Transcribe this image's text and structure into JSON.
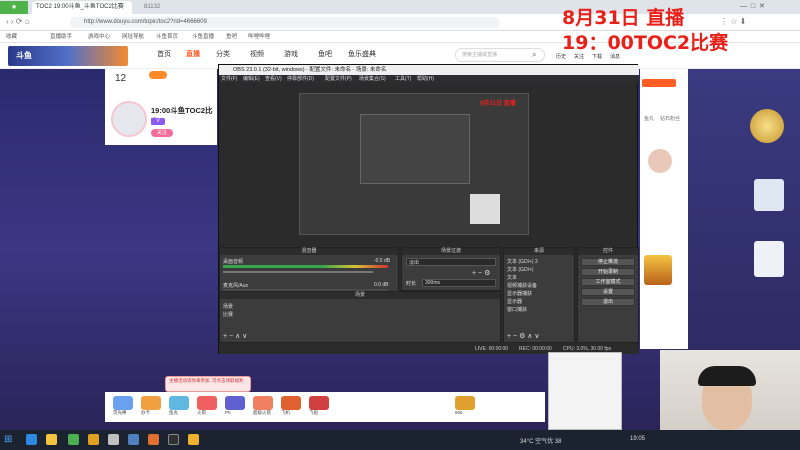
{
  "browser": {
    "tabs": [
      {
        "label": "TOC2 19:00斗鱼_斗鱼TOC2比赛"
      },
      {
        "label": "81132"
      }
    ],
    "url": "http://www.douyu.com/topic/toc2?rid=4666609",
    "bookmarks": [
      "收藏",
      "直播助手",
      "游戏中心",
      "网址导航",
      "斗鱼首页",
      "斗鱼直播",
      "鱼吧",
      "哔哩哔哩",
      "优酷视频"
    ]
  },
  "site": {
    "logo": "斗鱼",
    "nav": [
      "首页",
      "直播",
      "分类",
      "视频",
      "游戏",
      "鱼吧",
      "鱼乐盛典"
    ],
    "active_nav": "直播",
    "search_placeholder": "搜索主播或直播",
    "header_right": [
      "历史",
      "关注",
      "下载",
      "消息"
    ]
  },
  "room": {
    "follow_count": "12",
    "title": "19:00斗鱼TOC2比赛",
    "badge": "V",
    "follow_label": "关注",
    "sidebar_right": [
      "鱼丸",
      "钻石粉丝",
      "贵宾"
    ]
  },
  "overlay": {
    "line1": "8月31日 直播",
    "line2": "19：00TOC2比赛"
  },
  "obs": {
    "title": "OBS 23.0.1 (32-bit, windows) - 配置文件: 未命名 - 场景: 未命名",
    "menu": [
      "文件(F)",
      "编辑(E)",
      "查看(V)",
      "停靠部件(D)",
      "配置文件(P)",
      "场景集合(S)",
      "工具(T)",
      "帮助(H)"
    ],
    "docks": {
      "mixer": {
        "title": "混音器",
        "rows": [
          {
            "name": "桌面音频",
            "db": "-0.5 dB"
          },
          {
            "name": "麦克风/Aux",
            "db": "0.0 dB"
          }
        ]
      },
      "transition": {
        "title": "场景过渡",
        "type": "淡出",
        "duration_label": "时长",
        "duration": "300ms"
      },
      "scenes": {
        "title": "场景",
        "items": [
          "场景",
          "比赛"
        ]
      },
      "sources": {
        "title": "来源",
        "items": [
          "文本 (GDI+) 3",
          "文本 (GDI+)",
          "文本",
          "视频捕获设备",
          "显示器捕获",
          "显示器",
          "窗口捕获"
        ]
      },
      "controls": {
        "title": "控件",
        "buttons": [
          "停止推流",
          "开始录制",
          "工作室模式",
          "设置",
          "退出"
        ]
      }
    },
    "status": {
      "live": "LIVE: 00:00:00",
      "rec": "REC: 00:00:00",
      "cpu": "CPU: 3.0%, 30.00 fps"
    }
  },
  "gifts": [
    "荧光棒",
    "办卡",
    "鱼丸",
    "火箭",
    "PK",
    "超级火箭",
    "飞机",
    "飞船",
    "666"
  ],
  "promo": "主播活动等你来参加, 可点击领取福利",
  "taskbar": {
    "weather": "34°C 空气优 38",
    "clock": "19:05"
  },
  "colors": {
    "brand": "#ff5d23",
    "overlay_red": "#e8201a",
    "obs_bg": "#2b2b2b"
  }
}
